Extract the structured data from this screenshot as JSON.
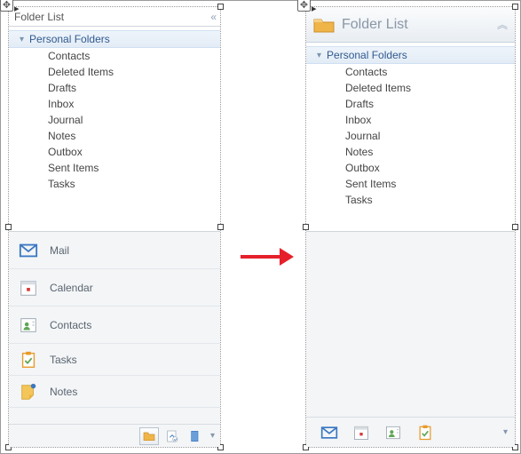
{
  "title": "Folder List",
  "tree": {
    "root": "Personal Folders",
    "items": [
      "Contacts",
      "Deleted Items",
      "Drafts",
      "Inbox",
      "Journal",
      "Notes",
      "Outbox",
      "Sent Items",
      "Tasks"
    ]
  },
  "nav": {
    "items": [
      {
        "label": "Mail",
        "icon": "mail"
      },
      {
        "label": "Calendar",
        "icon": "calendar"
      },
      {
        "label": "Contacts",
        "icon": "contacts"
      },
      {
        "label": "Tasks",
        "icon": "tasks"
      },
      {
        "label": "Notes",
        "icon": "notes"
      }
    ]
  },
  "bottomLeft": {
    "buttons": [
      {
        "icon": "folder",
        "selected": true
      },
      {
        "icon": "shortcuts",
        "selected": false
      },
      {
        "icon": "book",
        "selected": false
      }
    ]
  },
  "bottomRight": {
    "buttons": [
      {
        "icon": "mail"
      },
      {
        "icon": "calendar"
      },
      {
        "icon": "contacts"
      },
      {
        "icon": "tasks"
      }
    ]
  },
  "colors": {
    "accent": "#3a78c2",
    "orange": "#e89a2b",
    "green": "#5fa756"
  }
}
